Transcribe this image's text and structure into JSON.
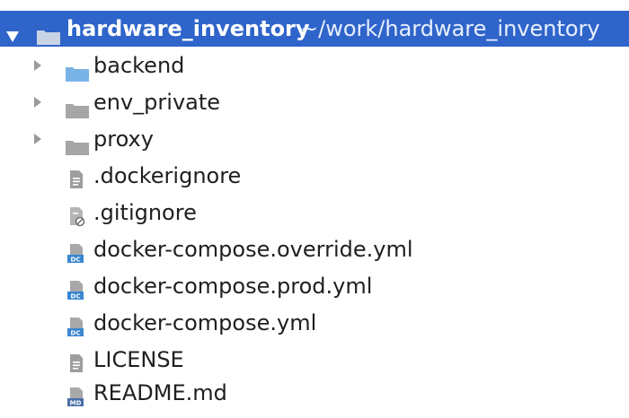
{
  "project": {
    "name": "hardware_inventory",
    "path": "~/work/hardware_inventory"
  },
  "items": [
    {
      "label": "backend",
      "kind": "folder",
      "icon": "folder-blue-icon",
      "color": "#7ab3e6"
    },
    {
      "label": "env_private",
      "kind": "folder",
      "icon": "folder-icon",
      "color": "#a6a6a6"
    },
    {
      "label": "proxy",
      "kind": "folder",
      "icon": "folder-icon",
      "color": "#a6a6a6"
    },
    {
      "label": ".dockerignore",
      "kind": "file",
      "icon": "text-file-icon"
    },
    {
      "label": ".gitignore",
      "kind": "file",
      "icon": "ignore-file-icon"
    },
    {
      "label": "docker-compose.override.yml",
      "kind": "file",
      "icon": "docker-compose-file-icon"
    },
    {
      "label": "docker-compose.prod.yml",
      "kind": "file",
      "icon": "docker-compose-file-icon"
    },
    {
      "label": "docker-compose.yml",
      "kind": "file",
      "icon": "docker-compose-file-icon"
    },
    {
      "label": "LICENSE",
      "kind": "file",
      "icon": "text-file-icon"
    },
    {
      "label": "README.md",
      "kind": "file",
      "icon": "markdown-file-icon"
    }
  ],
  "colors": {
    "selection": "#2f65ca",
    "folder": "#a6a6a6",
    "folder_accent": "#7ab3e6"
  }
}
